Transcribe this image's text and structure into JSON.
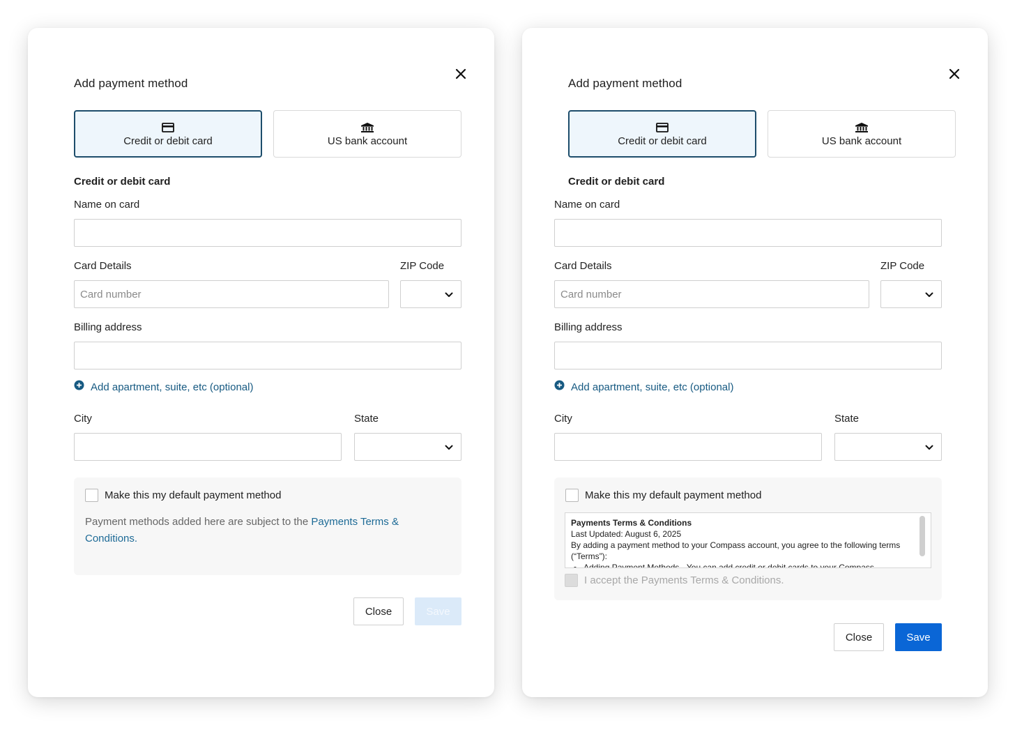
{
  "modals": [
    {
      "title": "Add payment method",
      "tabs": [
        {
          "label": "Credit or debit card",
          "icon": "credit-card-icon",
          "selected": true
        },
        {
          "label": "US bank account",
          "icon": "bank-icon",
          "selected": false
        }
      ],
      "section_heading": "Credit or debit card",
      "name_on_card": {
        "label": "Name on card",
        "value": ""
      },
      "card_details": {
        "label": "Card Details",
        "placeholder": "Card number",
        "value": ""
      },
      "zip": {
        "label": "ZIP Code",
        "value": ""
      },
      "billing_address": {
        "label": "Billing address",
        "value": ""
      },
      "add_apartment": "Add apartment, suite, etc (optional)",
      "city": {
        "label": "City",
        "value": ""
      },
      "state": {
        "label": "State",
        "value": ""
      },
      "default_checkbox": {
        "label": "Make this my default payment method",
        "checked": false
      },
      "terms_note_prefix": "Payment methods added here are subject to the",
      "terms_link": "Payments Terms & Conditions.",
      "close_label": "Close",
      "save_label": "Save",
      "save_enabled": false
    },
    {
      "title": "Add payment method",
      "tabs": [
        {
          "label": "Credit or debit card",
          "icon": "credit-card-icon",
          "selected": true
        },
        {
          "label": "US bank account",
          "icon": "bank-icon",
          "selected": false
        }
      ],
      "section_heading": "Credit or debit card",
      "name_on_card": {
        "label": "Name on card",
        "value": ""
      },
      "card_details": {
        "label": "Card Details",
        "placeholder": "Card number",
        "value": ""
      },
      "zip": {
        "label": "ZIP Code",
        "value": ""
      },
      "billing_address": {
        "label": "Billing address",
        "value": ""
      },
      "add_apartment": "Add apartment, suite, etc (optional)",
      "city": {
        "label": "City",
        "value": ""
      },
      "state": {
        "label": "State",
        "value": ""
      },
      "default_checkbox": {
        "label": "Make this my default payment method",
        "checked": false
      },
      "terms_scroll": {
        "title": "Payments Terms & Conditions",
        "updated": "Last Updated: August 6, 2025",
        "intro": "By adding a payment method to your Compass account, you agree to the following terms (“Terms”):",
        "bullet": "Adding Payment Methods - You can add credit or debit cards to your Compass"
      },
      "accept_checkbox": {
        "label": "I accept the Payments Terms & Conditions.",
        "checked": false,
        "disabled": true
      },
      "close_label": "Close",
      "save_label": "Save",
      "save_enabled": true
    }
  ],
  "colors": {
    "accent_border": "#1d4d6b",
    "selected_tab_bg": "#eef6fc",
    "link": "#175a82",
    "save_enabled": "#0a66d6",
    "save_disabled": "#dbeaf9"
  }
}
